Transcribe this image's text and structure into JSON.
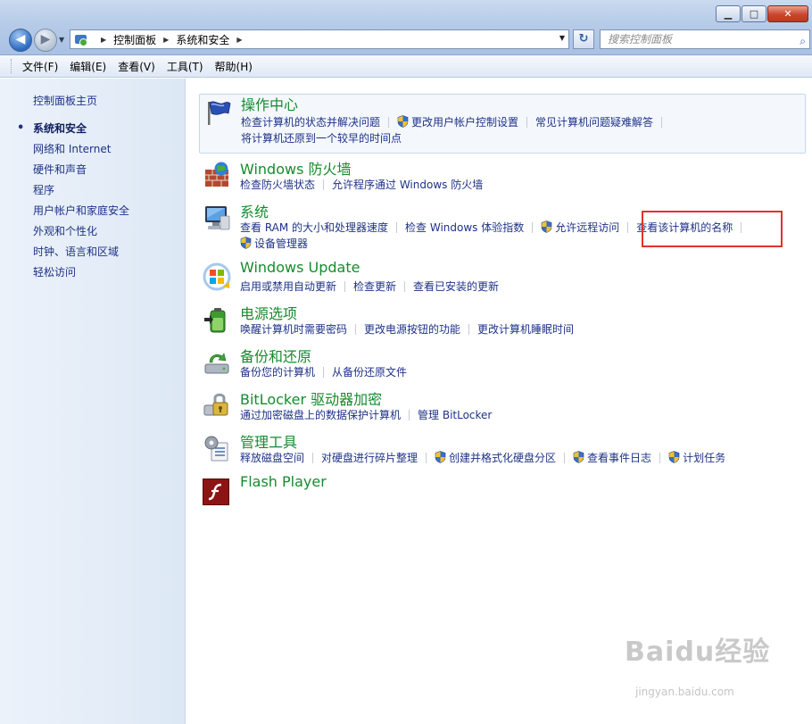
{
  "window": {
    "minimize": "▁",
    "maximize": "□",
    "close": "✕"
  },
  "nav": {
    "breadcrumbs": [
      "控制面板",
      "系统和安全"
    ],
    "search_placeholder": "搜索控制面板"
  },
  "menu": [
    "文件(F)",
    "编辑(E)",
    "查看(V)",
    "工具(T)",
    "帮助(H)"
  ],
  "sidebar": {
    "home": "控制面板主页",
    "items": [
      {
        "label": "系统和安全",
        "current": true
      },
      {
        "label": "网络和 Internet"
      },
      {
        "label": "硬件和声音"
      },
      {
        "label": "程序"
      },
      {
        "label": "用户帐户和家庭安全"
      },
      {
        "label": "外观和个性化"
      },
      {
        "label": "时钟、语言和区域"
      },
      {
        "label": "轻松访问"
      }
    ]
  },
  "categories": {
    "action_center": {
      "title": "操作中心",
      "links": [
        "检查计算机的状态并解决问题",
        "更改用户帐户控制设置",
        "常见计算机问题疑难解答"
      ],
      "links2": [
        "将计算机还原到一个较早的时间点"
      ]
    },
    "firewall": {
      "title": "Windows 防火墙",
      "links": [
        "检查防火墙状态",
        "允许程序通过 Windows 防火墙"
      ]
    },
    "system": {
      "title": "系统",
      "links": [
        "查看 RAM 的大小和处理器速度",
        "检查 Windows 体验指数",
        "允许远程访问",
        "查看该计算机的名称"
      ],
      "links2": [
        "设备管理器"
      ]
    },
    "windows_update": {
      "title": "Windows Update",
      "links": [
        "启用或禁用自动更新",
        "检查更新",
        "查看已安装的更新"
      ]
    },
    "power": {
      "title": "电源选项",
      "links": [
        "唤醒计算机时需要密码",
        "更改电源按钮的功能",
        "更改计算机睡眠时间"
      ]
    },
    "backup": {
      "title": "备份和还原",
      "links": [
        "备份您的计算机",
        "从备份还原文件"
      ]
    },
    "bitlocker": {
      "title": "BitLocker 驱动器加密",
      "links": [
        "通过加密磁盘上的数据保护计算机",
        "管理 BitLocker"
      ]
    },
    "admin_tools": {
      "title": "管理工具",
      "links": [
        "释放磁盘空间",
        "对硬盘进行碎片整理",
        "创建并格式化硬盘分区",
        "查看事件日志",
        "计划任务"
      ]
    },
    "flash": {
      "title": "Flash Player"
    }
  },
  "watermark": {
    "main": "Baidu经验",
    "sub": "jingyan.baidu.com"
  }
}
